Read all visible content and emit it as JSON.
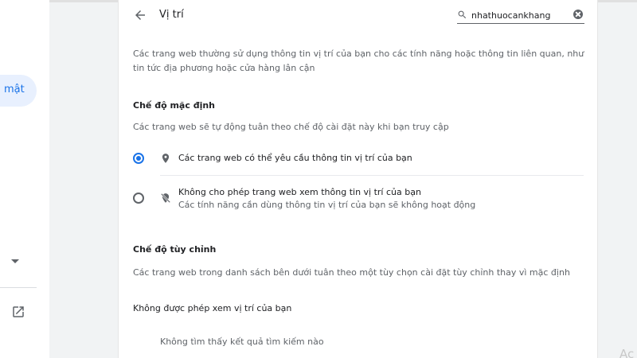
{
  "sidebar": {
    "active_item_label": "mật",
    "external_link_icon": "open-in-new-icon"
  },
  "header": {
    "back_icon": "arrow-back-icon",
    "title": "Vị trí",
    "search": {
      "value": "nhathuocankhang",
      "icon": "search-icon",
      "clear_icon": "clear-icon"
    }
  },
  "content": {
    "description": "Các trang web thường sử dụng thông tin vị trí của bạn cho các tính năng hoặc thông tin liên quan, như tin tức địa phương hoặc cửa hàng lân cận",
    "default_heading": "Chế độ mặc định",
    "default_description": "Các trang web sẽ tự động tuân theo chế độ cài đặt này khi bạn truy cập",
    "options": [
      {
        "label": "Các trang web có thể yêu cầu thông tin vị trí của bạn",
        "sublabel": "",
        "selected": true,
        "icon": "location-pin-icon"
      },
      {
        "label": "Không cho phép trang web xem thông tin vị trí của bạn",
        "sublabel": "Các tính năng cần dùng thông tin vị trí của bạn sẽ không hoạt động",
        "selected": false,
        "icon": "location-off-icon"
      }
    ],
    "custom_heading": "Chế độ tùy chỉnh",
    "custom_description": "Các trang web trong danh sách bên dưới tuân theo một tùy chọn cài đặt tùy chỉnh thay vì mặc định",
    "blocked_label": "Không được phép xem vị trí của bạn",
    "no_results": "Không tìm thấy kết quả tìm kiếm nào"
  },
  "watermark": "Ac",
  "colors": {
    "accent": "#1a73e8",
    "text_primary": "#202124",
    "text_secondary": "#5f6368",
    "background": "#f1f3f4"
  }
}
